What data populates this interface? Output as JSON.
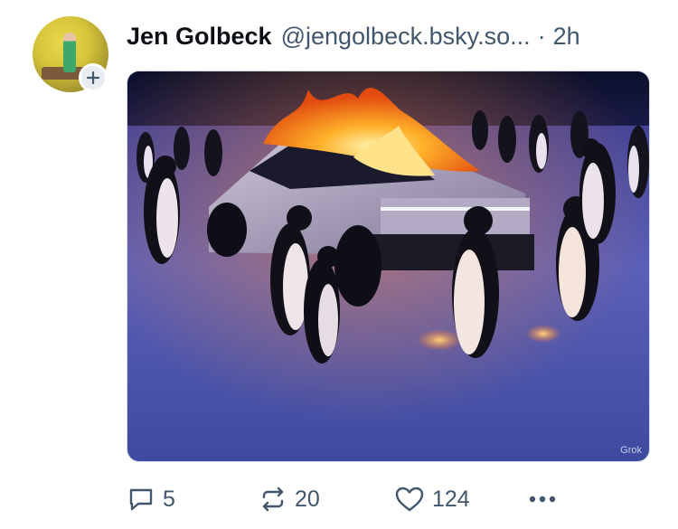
{
  "post": {
    "author": {
      "display_name": "Jen Golbeck",
      "handle": "@jengolbeck.bsky.so...",
      "separator": "·",
      "timestamp": "2h"
    },
    "media": {
      "watermark": "Grok"
    },
    "actions": {
      "reply_count": "5",
      "repost_count": "20",
      "like_count": "124",
      "more_label": "•••"
    }
  },
  "colors": {
    "text_primary": "#0b0f14",
    "text_secondary": "#42576c",
    "border": "#d4dbe2"
  },
  "icons": [
    "plus-icon",
    "reply-icon",
    "repost-icon",
    "heart-icon",
    "more-icon"
  ]
}
